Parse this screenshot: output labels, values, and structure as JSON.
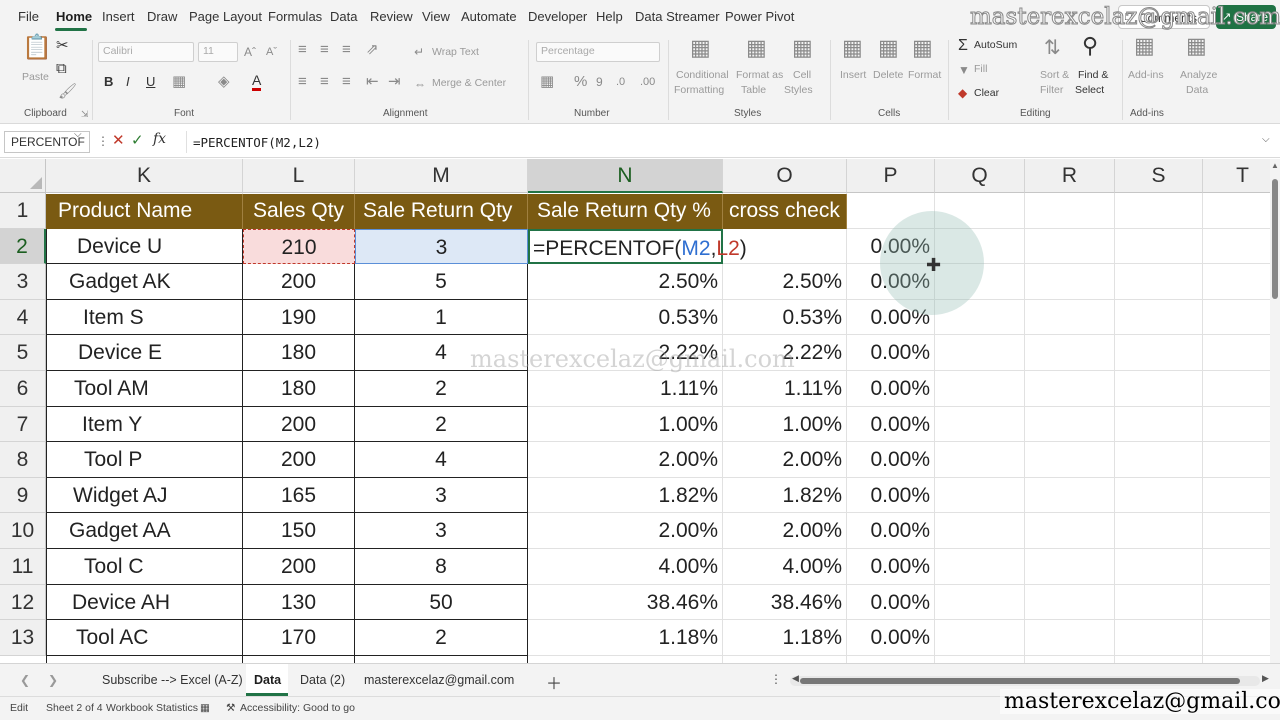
{
  "ribbon_tabs": [
    "File",
    "Home",
    "Insert",
    "Draw",
    "Page Layout",
    "Formulas",
    "Data",
    "Review",
    "View",
    "Automate",
    "Developer",
    "Help",
    "Data Streamer",
    "Power Pivot"
  ],
  "top_buttons": {
    "comments": "Comments",
    "share": "Share"
  },
  "ribbon": {
    "clipboard": {
      "paste": "Paste",
      "label": "Clipboard"
    },
    "font": {
      "name": "Calibri",
      "size": "11",
      "label": "Font"
    },
    "alignment": {
      "wrap_text": "Wrap Text",
      "merge_center": "Merge & Center",
      "label": "Alignment"
    },
    "number": {
      "format": "Percentage",
      "label": "Number"
    },
    "styles": {
      "conditional": "Conditional",
      "formatting": "Formatting",
      "format_as": "Format as",
      "table": "Table",
      "cell": "Cell",
      "styles_word": "Styles",
      "label": "Styles"
    },
    "cells": {
      "insert": "Insert",
      "delete": "Delete",
      "format": "Format",
      "label": "Cells"
    },
    "editing": {
      "autosum": "AutoSum",
      "fill": "Fill",
      "clear": "Clear",
      "sort": "Sort &",
      "filter": "Filter",
      "find": "Find &",
      "select": "Select",
      "label": "Editing"
    },
    "addins": {
      "addins": "Add-ins",
      "analyze": "Analyze",
      "data": "Data",
      "label": "Add-ins"
    }
  },
  "formula_bar": {
    "name_box": "PERCENTOF",
    "fx": "fx",
    "formula": "=PERCENTOF(M2,L2)"
  },
  "columns": [
    "K",
    "L",
    "M",
    "N",
    "O",
    "P",
    "Q",
    "R",
    "S",
    "T"
  ],
  "rows": [
    "1",
    "2",
    "3",
    "4",
    "5",
    "6",
    "7",
    "8",
    "9",
    "10",
    "11",
    "12",
    "13"
  ],
  "table": {
    "headers": [
      "Product Name",
      "Sales Qty",
      "Sale Return Qty",
      "Sale Return Qty  %",
      "cross check"
    ],
    "editing_cell": {
      "prefix": "=PERCENTOF(",
      "ref1": "M2",
      "comma": ",",
      "ref2": "L2",
      "suffix": ")"
    },
    "data": [
      {
        "name": "Device U",
        "sales": "210",
        "returns": "3",
        "pct": "",
        "check": "",
        "p": "0.00%"
      },
      {
        "name": "Gadget AK",
        "sales": "200",
        "returns": "5",
        "pct": "2.50%",
        "check": "2.50%",
        "p": "0.00%"
      },
      {
        "name": "Item S",
        "sales": "190",
        "returns": "1",
        "pct": "0.53%",
        "check": "0.53%",
        "p": "0.00%"
      },
      {
        "name": "Device E",
        "sales": "180",
        "returns": "4",
        "pct": "2.22%",
        "check": "2.22%",
        "p": "0.00%"
      },
      {
        "name": "Tool AM",
        "sales": "180",
        "returns": "2",
        "pct": "1.11%",
        "check": "1.11%",
        "p": "0.00%"
      },
      {
        "name": "Item Y",
        "sales": "200",
        "returns": "2",
        "pct": "1.00%",
        "check": "1.00%",
        "p": "0.00%"
      },
      {
        "name": "Tool P",
        "sales": "200",
        "returns": "4",
        "pct": "2.00%",
        "check": "2.00%",
        "p": "0.00%"
      },
      {
        "name": "Widget AJ",
        "sales": "165",
        "returns": "3",
        "pct": "1.82%",
        "check": "1.82%",
        "p": "0.00%"
      },
      {
        "name": "Gadget AA",
        "sales": "150",
        "returns": "3",
        "pct": "2.00%",
        "check": "2.00%",
        "p": "0.00%"
      },
      {
        "name": "Tool C",
        "sales": "200",
        "returns": "8",
        "pct": "4.00%",
        "check": "4.00%",
        "p": "0.00%"
      },
      {
        "name": "Device AH",
        "sales": "130",
        "returns": "50",
        "pct": "38.46%",
        "check": "38.46%",
        "p": "0.00%"
      },
      {
        "name": "Tool AC",
        "sales": "170",
        "returns": "2",
        "pct": "1.18%",
        "check": "1.18%",
        "p": "0.00%"
      }
    ]
  },
  "sheet_tabs": [
    "Subscribe --> Excel (A-Z)",
    "Data",
    "Data (2)",
    "masterexcelaz@gmail.com"
  ],
  "active_sheet": "Data",
  "status": {
    "mode": "Edit",
    "sheet": "Sheet 2 of 4",
    "workbook_stats": "Workbook Statistics",
    "accessibility": "Accessibility: Good to go"
  },
  "watermark": "masterexcelaz@gmail.com",
  "colors": {
    "header_fill": "#7a5a12",
    "accent": "#217346",
    "ref_blue": "#2f6fd1",
    "ref_red": "#c0392b"
  }
}
